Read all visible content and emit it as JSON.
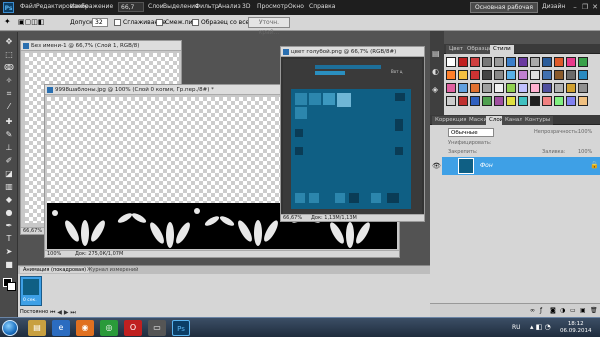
{
  "app": {
    "logo": "Ps",
    "zoom": "66,7"
  },
  "menu": [
    "Файл",
    "Редактирование",
    "Изображение",
    "Слои",
    "Выделение",
    "Фильтр",
    "Анализ",
    "3D",
    "Просмотр",
    "Окно",
    "Справка"
  ],
  "workspace": {
    "button": "Основная рабочая среда",
    "design": "Дизайн"
  },
  "options": {
    "tolerance_label": "Допуск:",
    "tolerance_value": "32",
    "antialias": "Сглаживание",
    "contiguous": "Смеж.пикс",
    "sample_all": "Образец со всех слоев",
    "refine_edge": "Уточн. край..."
  },
  "docs": {
    "doc1": {
      "title": "Без имени-1 @ 66,7% (Слой 1, RGB/8)",
      "zoom": "66,67%"
    },
    "doc2": {
      "title": "9998шаблоны.jpg @ 100% (Слой 0 копия, Гр.пер./8#) *",
      "zoom": "100%",
      "status": "Док: 275,0К/1,07М"
    },
    "doc3": {
      "title": "цвет голубой.png @ 66,7% (RGB/8#)",
      "zoom": "66,67%",
      "status": "Док: 1,13М/1,13М",
      "layer_label": "Вот ц"
    }
  },
  "swatches_panel": {
    "tabs": [
      "Цвет",
      "Образцы",
      "Стили"
    ],
    "active": "Стили"
  },
  "layers_panel": {
    "tabs": [
      "Коррекция",
      "Маски",
      "Слои",
      "Каналы",
      "Контуры"
    ],
    "active": "Слои",
    "mode": "Обычные",
    "opacity_label": "Непрозрачность:",
    "opacity_value": "100%",
    "unify_label": "Унифицировать:",
    "lock_label": "Закрепить:",
    "fill_label": "Заливка:",
    "fill_value": "100%",
    "layer_name": "Фон",
    "accent": "#3ea0e6"
  },
  "animation": {
    "tabs": [
      "Анимация (покадровая)",
      "Журнал измерений"
    ],
    "frame_time": "0 сек.",
    "loop": "Постоянно"
  },
  "taskbar": {
    "time": "18:12",
    "date": "06.09.2014",
    "lang": "RU"
  }
}
